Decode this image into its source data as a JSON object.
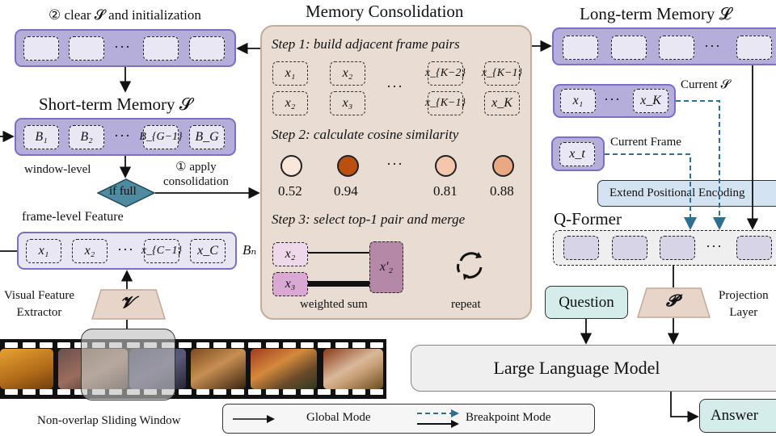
{
  "top_left": {
    "caption_num": "②",
    "caption": " clear 𝓢 and initialization"
  },
  "short_term": {
    "title": "Short-term Memory 𝓢",
    "slots": [
      "B₁",
      "B₂",
      "B_{G−1}",
      "B_G"
    ],
    "window_label": "window-level",
    "decision": "if full",
    "apply_num": "①",
    "apply_label_1": "apply",
    "apply_label_2": "consolidation"
  },
  "frame_level": {
    "title": "frame-level Feature",
    "slots": [
      "x₁",
      "x₂",
      "x_{C−1}",
      "x_C"
    ],
    "group_label": "Bₙ"
  },
  "extractor": {
    "label_1": "Visual Feature",
    "label_2": "Extractor",
    "symbol": "𝓥"
  },
  "film": {
    "caption": "Non-overlap Sliding Window"
  },
  "consolidation": {
    "title": "Memory Consolidation",
    "step1": "Step 1: build adjacent frame pairs",
    "pairs_top": [
      "x₁",
      "x₂",
      "x_{K−2}",
      "x_{K−1}"
    ],
    "pairs_bottom": [
      "x₂",
      "x₃",
      "x_{K−1}",
      "x_K"
    ],
    "step2": "Step 2: calculate cosine similarity",
    "similarities": [
      {
        "value": "0.52",
        "color": "#fbe6dc"
      },
      {
        "value": "0.94",
        "color": "#b9500f"
      },
      {
        "value": "0.81",
        "color": "#f4c6ac"
      },
      {
        "value": "0.88",
        "color": "#eaa882"
      }
    ],
    "step3": "Step 3: select top-1 pair and merge",
    "merge_a": "x₂",
    "merge_b": "x₃",
    "merged": "x′₂",
    "weighted_sum": "weighted sum",
    "repeat": "repeat"
  },
  "long_term": {
    "title": "Long-term Memory 𝓛"
  },
  "current_s": {
    "label": "Current 𝓢",
    "slots": [
      "x₁",
      "x_K"
    ]
  },
  "current_frame": {
    "label": "Current Frame",
    "slot": "x_t"
  },
  "extend_pe": "Extend Positional Encoding",
  "qformer": {
    "title": "Q-Former"
  },
  "question": "Question",
  "projection": {
    "symbol": "𝓟",
    "label_1": "Projection",
    "label_2": "Layer"
  },
  "llm": "Large Language Model",
  "answer": "Answer",
  "legend": {
    "global": "Global Mode",
    "breakpoint": "Breakpoint Mode"
  },
  "colors": {
    "memory_purple": "#b5aedb",
    "memory_border": "#7c6fc4",
    "panel_beige": "#e9dcd2",
    "decision_teal": "#4e8aa0",
    "breakpoint_blue": "#2f6f8f",
    "answer_teal": "#d4ecea",
    "pe_blue": "#d3e3f1"
  }
}
